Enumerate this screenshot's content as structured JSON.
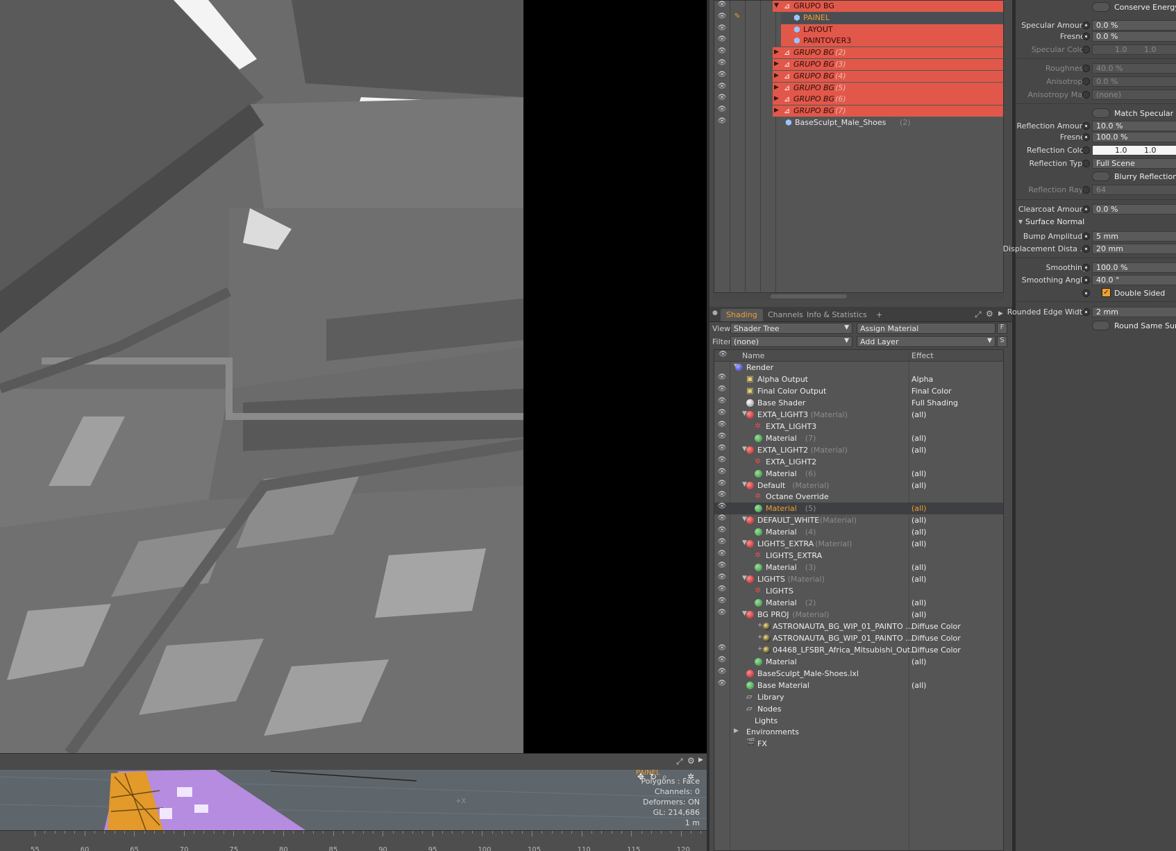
{
  "items_list": {
    "rows": [
      {
        "name": "GRUPO BG",
        "suffix": "",
        "italic": false,
        "highlight": "red",
        "expanded": true
      },
      {
        "name": "PAINEL",
        "suffix": "",
        "italic": false,
        "highlight": "selected",
        "expanded": false
      },
      {
        "name": "LAYOUT",
        "suffix": "",
        "italic": false,
        "highlight": "red",
        "expanded": false
      },
      {
        "name": "PAINTOVER3",
        "suffix": "",
        "italic": false,
        "highlight": "red",
        "expanded": false
      },
      {
        "name": "GRUPO BG",
        "suffix": "(2)",
        "italic": true,
        "highlight": "red",
        "expanded": false
      },
      {
        "name": "GRUPO BG",
        "suffix": "(3)",
        "italic": true,
        "highlight": "red",
        "expanded": false
      },
      {
        "name": "GRUPO BG",
        "suffix": "(4)",
        "italic": true,
        "highlight": "red",
        "expanded": false
      },
      {
        "name": "GRUPO BG",
        "suffix": "(5)",
        "italic": true,
        "highlight": "red",
        "expanded": false
      },
      {
        "name": "GRUPO BG",
        "suffix": "(6)",
        "italic": true,
        "highlight": "red",
        "expanded": false
      },
      {
        "name": "GRUPO BG",
        "suffix": "(7)",
        "italic": true,
        "highlight": "red",
        "expanded": false
      },
      {
        "name": "BaseSculpt_Male_Shoes",
        "suffix": "(2)",
        "italic": false,
        "highlight": "none",
        "expanded": false
      }
    ]
  },
  "tabs": [
    {
      "label": "Shading",
      "active": true
    },
    {
      "label": "Channels",
      "active": false
    },
    {
      "label": "Info & Statistics",
      "active": false
    },
    {
      "label": "+",
      "active": false
    }
  ],
  "shading_toolbar": {
    "view_label": "View",
    "view_value": "Shader Tree",
    "assign_material": "Assign Material",
    "assign_shortcut": "F",
    "filter_label": "Filter",
    "filter_value": "(none)",
    "add_layer": "Add Layer",
    "add_layer_shortcut": "S"
  },
  "shader_tree": {
    "col_name": "Name",
    "col_effect": "Effect",
    "rows": [
      {
        "name": "Render",
        "suffix": "",
        "effect": "",
        "icon": "render-sphere-icon",
        "level": 0,
        "eye": false
      },
      {
        "name": "Alpha Output",
        "suffix": "",
        "effect": "Alpha",
        "icon": "output-icon",
        "level": 1,
        "eye": true
      },
      {
        "name": "Final Color Output",
        "suffix": "",
        "effect": "Final Color",
        "icon": "output-icon",
        "level": 1,
        "eye": true
      },
      {
        "name": "Base Shader",
        "suffix": "",
        "effect": "Full Shading",
        "icon": "shader-ball-icon",
        "level": 1,
        "eye": true
      },
      {
        "name": "EXTA_LIGHT3",
        "suffix": "(Material)",
        "effect": "(all)",
        "icon": "material-group-icon",
        "level": 1,
        "eye": true
      },
      {
        "name": "EXTA_LIGHT3",
        "suffix": "",
        "effect": "",
        "icon": "octane-icon",
        "level": 2,
        "eye": true
      },
      {
        "name": "Material",
        "suffix": "(7)",
        "effect": "(all)",
        "icon": "material-ball-icon",
        "level": 2,
        "eye": true
      },
      {
        "name": "EXTA_LIGHT2",
        "suffix": "(Material)",
        "effect": "(all)",
        "icon": "material-group-icon",
        "level": 1,
        "eye": true
      },
      {
        "name": "EXTA_LIGHT2",
        "suffix": "",
        "effect": "",
        "icon": "octane-icon",
        "level": 2,
        "eye": true
      },
      {
        "name": "Material",
        "suffix": "(6)",
        "effect": "(all)",
        "icon": "material-ball-icon",
        "level": 2,
        "eye": true
      },
      {
        "name": "Default",
        "suffix": "(Material)",
        "effect": "(all)",
        "icon": "material-group-icon",
        "level": 1,
        "eye": true
      },
      {
        "name": "Octane Override",
        "suffix": "",
        "effect": "",
        "icon": "octane-icon",
        "level": 2,
        "eye": true
      },
      {
        "name": "Material",
        "suffix": "(5)",
        "effect": "(all)",
        "icon": "material-ball-icon",
        "level": 2,
        "eye": true,
        "selected": true
      },
      {
        "name": "DEFAULT_WHITE",
        "suffix": "(Material)",
        "effect": "(all)",
        "icon": "material-group-icon",
        "level": 1,
        "eye": true
      },
      {
        "name": "Material",
        "suffix": "(4)",
        "effect": "(all)",
        "icon": "material-ball-icon",
        "level": 2,
        "eye": true
      },
      {
        "name": "LIGHTS_EXTRA",
        "suffix": "(Material)",
        "effect": "(all)",
        "icon": "material-group-icon",
        "level": 1,
        "eye": true
      },
      {
        "name": "LIGHTS_EXTRA",
        "suffix": "",
        "effect": "",
        "icon": "octane-icon",
        "level": 2,
        "eye": true
      },
      {
        "name": "Material",
        "suffix": "(3)",
        "effect": "(all)",
        "icon": "material-ball-icon",
        "level": 2,
        "eye": true
      },
      {
        "name": "LIGHTS",
        "suffix": "(Material)",
        "effect": "(all)",
        "icon": "material-group-icon",
        "level": 1,
        "eye": true
      },
      {
        "name": "LIGHTS",
        "suffix": "",
        "effect": "",
        "icon": "octane-icon",
        "level": 2,
        "eye": true
      },
      {
        "name": "Material",
        "suffix": "(2)",
        "effect": "(all)",
        "icon": "material-ball-icon",
        "level": 2,
        "eye": true
      },
      {
        "name": "BG PROJ",
        "suffix": "(Material)",
        "effect": "(all)",
        "icon": "material-group-icon",
        "level": 1,
        "eye": true
      },
      {
        "name": "ASTRONAUTA_BG_WIP_01_PAINTO ...",
        "suffix": "",
        "effect": "Diffuse Color",
        "icon": "image-map-icon",
        "level": 2,
        "eye": false
      },
      {
        "name": "ASTRONAUTA_BG_WIP_01_PAINTO ...",
        "suffix": "",
        "effect": "Diffuse Color",
        "icon": "image-map-icon",
        "level": 2,
        "eye": false
      },
      {
        "name": "04468_LFSBR_Africa_Mitsubishi_Out...",
        "suffix": "",
        "effect": "Diffuse Color",
        "icon": "image-map-icon",
        "level": 2,
        "eye": true
      },
      {
        "name": "Material",
        "suffix": "",
        "effect": "(all)",
        "icon": "material-ball-icon",
        "level": 2,
        "eye": true
      },
      {
        "name": "BaseSculpt_Male-Shoes.lxl",
        "suffix": "",
        "effect": "",
        "icon": "material-group-icon",
        "level": 1,
        "eye": true
      },
      {
        "name": "Base Material",
        "suffix": "",
        "effect": "(all)",
        "icon": "material-ball-icon",
        "level": 1,
        "eye": true
      },
      {
        "name": "Library",
        "suffix": "",
        "effect": "",
        "icon": "folder-icon",
        "level": 1,
        "eye": false
      },
      {
        "name": "Nodes",
        "suffix": "",
        "effect": "",
        "icon": "folder-icon",
        "level": 1,
        "eye": false
      },
      {
        "name": "Lights",
        "suffix": "",
        "effect": "",
        "icon": "",
        "level": 0,
        "eye": false
      },
      {
        "name": "Environments",
        "suffix": "",
        "effect": "",
        "icon": "",
        "level": 0,
        "eye": false
      },
      {
        "name": "FX",
        "suffix": "",
        "effect": "",
        "icon": "clapper-icon",
        "level": 1,
        "eye": false
      }
    ]
  },
  "properties": {
    "conserve_energy": "Conserve Energy",
    "specular_amount_label": "Specular Amount",
    "specular_amount": "0.0 %",
    "fresnel_label": "Fresnel",
    "fresnel": "0.0 %",
    "specular_color_label": "Specular Color",
    "specular_color_1": "1.0",
    "specular_color_2": "1.0",
    "roughness_label": "Roughness",
    "roughness": "40.0 %",
    "anisotropy_label": "Anisotropy",
    "anisotropy": "0.0 %",
    "anisotropy_map_label": "Anisotropy Map",
    "anisotropy_map": "(none)",
    "match_specular": "Match Specular",
    "reflection_amount_label": "Reflection Amount",
    "reflection_amount": "10.0 %",
    "fresnel2_label": "Fresnel",
    "fresnel2": "100.0 %",
    "reflection_color_label": "Reflection Color",
    "reflection_color_1": "1.0",
    "reflection_color_2": "1.0",
    "reflection_type_label": "Reflection Type",
    "reflection_type": "Full Scene",
    "blurry_reflection": "Blurry Reflection",
    "reflection_rays_label": "Reflection Rays",
    "reflection_rays": "64",
    "clearcoat_label": "Clearcoat Amount",
    "clearcoat": "0.0 %",
    "surface_normal": "Surface Normal",
    "bump_label": "Bump Amplitude",
    "bump": "5 mm",
    "displacement_label": "Displacement Dista ...",
    "displacement": "20 mm",
    "smoothing_label": "Smoothing",
    "smoothing": "100.0 %",
    "smoothing_angle_label": "Smoothing Angle",
    "smoothing_angle": "40.0 °",
    "double_sided": "Double Sided",
    "rounded_edge_label": "Rounded Edge Width",
    "rounded_edge": "2 mm",
    "round_same_surface": "Round Same Surfa"
  },
  "mini_viewport": {
    "item_label": "PAINEL",
    "stats": [
      "Polygons : Face",
      "Channels: 0",
      "Deformers: ON",
      "GL: 214,686",
      "1 m"
    ],
    "axis_label": "+X"
  },
  "timeline": {
    "ticks": [
      "55",
      "60",
      "65",
      "70",
      "75",
      "80",
      "85",
      "90",
      "95",
      "100",
      "105",
      "110",
      "115",
      "120"
    ]
  },
  "colors": {
    "accent": "#f0a030",
    "highlight_red": "#e1584a",
    "selection_bg": "#3d3f43"
  }
}
